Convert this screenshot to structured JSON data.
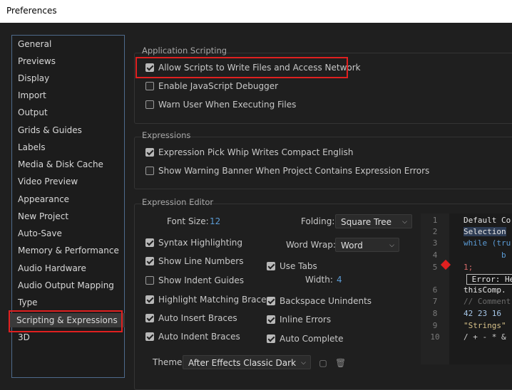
{
  "window": {
    "title": "Preferences"
  },
  "sidebar": {
    "items": [
      {
        "label": "General"
      },
      {
        "label": "Previews"
      },
      {
        "label": "Display"
      },
      {
        "label": "Import"
      },
      {
        "label": "Output"
      },
      {
        "label": "Grids & Guides"
      },
      {
        "label": "Labels"
      },
      {
        "label": "Media & Disk Cache"
      },
      {
        "label": "Video Preview"
      },
      {
        "label": "Appearance"
      },
      {
        "label": "New Project"
      },
      {
        "label": "Auto-Save"
      },
      {
        "label": "Memory & Performance"
      },
      {
        "label": "Audio Hardware"
      },
      {
        "label": "Audio Output Mapping"
      },
      {
        "label": "Type"
      },
      {
        "label": "Scripting & Expressions",
        "selected": true
      },
      {
        "label": "3D"
      }
    ]
  },
  "app_scripting": {
    "title": "Application Scripting",
    "allow_scripts": {
      "label": "Allow Scripts to Write Files and Access Network",
      "checked": true
    },
    "enable_debugger": {
      "label": "Enable JavaScript Debugger",
      "checked": false
    },
    "warn_user": {
      "label": "Warn User When Executing Files",
      "checked": false
    }
  },
  "expressions": {
    "title": "Expressions",
    "pick_whip": {
      "label": "Expression Pick Whip Writes Compact English",
      "checked": true
    },
    "warning_banner": {
      "label": "Show Warning Banner When Project Contains Expression Errors",
      "checked": false
    }
  },
  "expression_editor": {
    "title": "Expression Editor",
    "font_size_label": "Font Size:",
    "font_size_value": "12",
    "folding_label": "Folding:",
    "folding_value": "Square Tree",
    "word_wrap_label": "Word Wrap:",
    "word_wrap_value": "Word",
    "use_tabs": {
      "label": "Use Tabs",
      "checked": true
    },
    "width_label": "Width:",
    "width_value": "4",
    "syntax_highlighting": {
      "label": "Syntax Highlighting",
      "checked": true
    },
    "show_line_numbers": {
      "label": "Show Line Numbers",
      "checked": true
    },
    "show_indent_guides": {
      "label": "Show Indent Guides",
      "checked": false
    },
    "highlight_braces": {
      "label": "Highlight Matching Braces",
      "checked": true
    },
    "auto_insert_braces": {
      "label": "Auto Insert Braces",
      "checked": true
    },
    "auto_indent_braces": {
      "label": "Auto Indent Braces",
      "checked": true
    },
    "backspace_unindents": {
      "label": "Backspace Unindents",
      "checked": true
    },
    "inline_errors": {
      "label": "Inline Errors",
      "checked": true
    },
    "auto_complete": {
      "label": "Auto Complete",
      "checked": true
    },
    "theme_label": "Theme:",
    "theme_value": "After Effects Classic Dark"
  },
  "code_preview": {
    "line_numbers": [
      "1",
      "2",
      "3",
      "4",
      "5",
      "",
      "6",
      "7",
      "8",
      "9",
      "10"
    ],
    "lines": [
      "Default Co",
      "Selection",
      "while (tru",
      "        b",
      "1;",
      " Error: He",
      "thisComp.",
      "// Comment",
      "42 23 16 ",
      "\"Strings\"",
      "/ + - * &"
    ]
  },
  "colors": {
    "accent": "#5b9bd5",
    "highlight_box": "#e02020",
    "error_marker": "#e02020"
  }
}
